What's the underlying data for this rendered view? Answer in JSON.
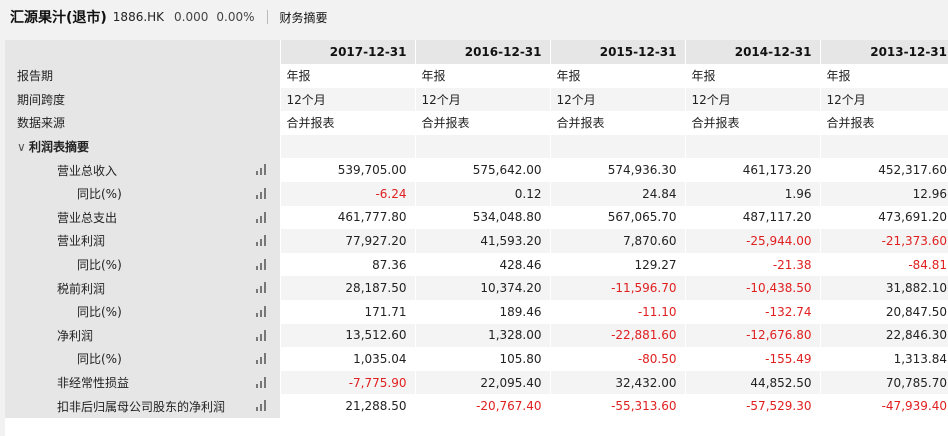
{
  "header": {
    "company": "汇源果汁(退市)",
    "code": "1886.HK",
    "price": "0.000",
    "change_pct": "0.00%",
    "section": "财务摘要"
  },
  "table": {
    "years": [
      "2017-12-31",
      "2016-12-31",
      "2015-12-31",
      "2014-12-31",
      "2013-12-31"
    ],
    "info_rows": [
      {
        "label": "报告期",
        "values": [
          "年报",
          "年报",
          "年报",
          "年报",
          "年报"
        ]
      },
      {
        "label": "期间跨度",
        "values": [
          "12个月",
          "12个月",
          "12个月",
          "12个月",
          "12个月"
        ]
      },
      {
        "label": "数据来源",
        "values": [
          "合并报表",
          "合并报表",
          "合并报表",
          "合并报表",
          "合并报表"
        ]
      }
    ],
    "section_label": "利润表摘要",
    "data_rows": [
      {
        "label": "营业总收入",
        "indent": 1,
        "values": [
          "539,705.00",
          "575,642.00",
          "574,936.30",
          "461,173.20",
          "452,317.60"
        ]
      },
      {
        "label": "同比(%)",
        "indent": 2,
        "values": [
          "-6.24",
          "0.12",
          "24.84",
          "1.96",
          "12.96"
        ]
      },
      {
        "label": "营业总支出",
        "indent": 1,
        "values": [
          "461,777.80",
          "534,048.80",
          "567,065.70",
          "487,117.20",
          "473,691.20"
        ]
      },
      {
        "label": "营业利润",
        "indent": 1,
        "values": [
          "77,927.20",
          "41,593.20",
          "7,870.60",
          "-25,944.00",
          "-21,373.60"
        ]
      },
      {
        "label": "同比(%)",
        "indent": 2,
        "values": [
          "87.36",
          "428.46",
          "129.27",
          "-21.38",
          "-84.81"
        ]
      },
      {
        "label": "税前利润",
        "indent": 1,
        "values": [
          "28,187.50",
          "10,374.20",
          "-11,596.70",
          "-10,438.50",
          "31,882.10"
        ]
      },
      {
        "label": "同比(%)",
        "indent": 2,
        "values": [
          "171.71",
          "189.46",
          "-11.10",
          "-132.74",
          "20,847.50"
        ]
      },
      {
        "label": "净利润",
        "indent": 1,
        "values": [
          "13,512.60",
          "1,328.00",
          "-22,881.60",
          "-12,676.80",
          "22,846.30"
        ]
      },
      {
        "label": "同比(%)",
        "indent": 2,
        "values": [
          "1,035.04",
          "105.80",
          "-80.50",
          "-155.49",
          "1,313.84"
        ]
      },
      {
        "label": "非经常性损益",
        "indent": 1,
        "values": [
          "-7,775.90",
          "22,095.40",
          "32,432.00",
          "44,852.50",
          "70,785.70"
        ]
      },
      {
        "label": "扣非后归属母公司股东的净利润",
        "indent": 1,
        "values": [
          "21,288.50",
          "-20,767.40",
          "-55,313.60",
          "-57,529.30",
          "-47,939.40"
        ]
      }
    ]
  },
  "colors": {
    "negative": "#e02020",
    "label_bg": "#e6e6e6",
    "alt_row": "#f4f4f4"
  },
  "icons": {
    "row_chart": "bar-chart-icon",
    "collapse": "chevron-down-icon"
  }
}
